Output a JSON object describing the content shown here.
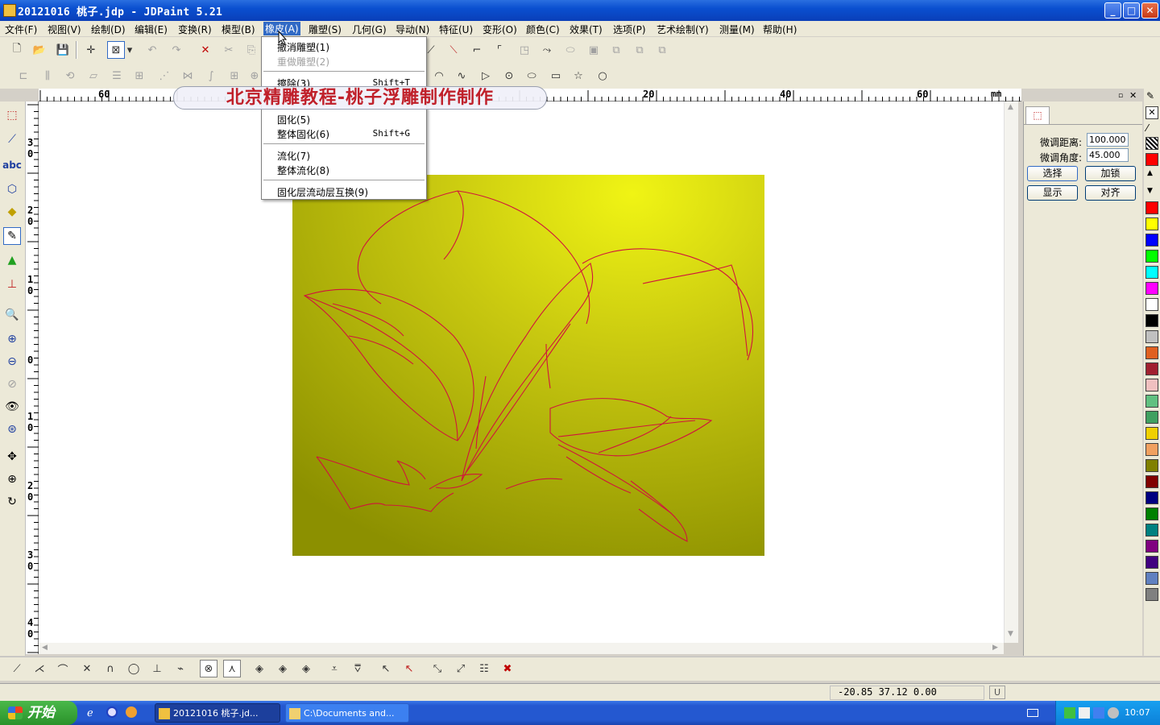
{
  "window": {
    "title": "20121016 桃子.jdp - JDPaint 5.21",
    "buttons": {
      "minimize": "_",
      "maximize": "□",
      "close": "✕"
    }
  },
  "menubar": [
    {
      "label": "文件(F)"
    },
    {
      "label": "视图(V)"
    },
    {
      "label": "绘制(D)"
    },
    {
      "label": "编辑(E)"
    },
    {
      "label": "变换(R)"
    },
    {
      "label": "模型(B)"
    },
    {
      "label": "橡皮(A)",
      "active": true
    },
    {
      "label": "雕塑(S)"
    },
    {
      "label": "几何(G)"
    },
    {
      "label": "导动(N)"
    },
    {
      "label": "特征(U)"
    },
    {
      "label": "变形(O)"
    },
    {
      "label": "颜色(C)"
    },
    {
      "label": "效果(T)"
    },
    {
      "label": "选项(P)"
    },
    {
      "label": "艺术绘制(Y)"
    },
    {
      "label": "测量(M)"
    },
    {
      "label": "帮助(H)"
    }
  ],
  "dropdown": {
    "items": [
      {
        "label": "撤消雕塑(1)",
        "shortcut": "",
        "disabled": false
      },
      {
        "label": "重做雕塑(2)",
        "shortcut": "",
        "disabled": true
      },
      {
        "label": "擦除(3)",
        "shortcut": "Shift+T",
        "disabled": false
      },
      {
        "label": "固化(5)",
        "shortcut": "",
        "disabled": false
      },
      {
        "label": "整体固化(6)",
        "shortcut": "Shift+G",
        "disabled": false
      },
      {
        "label": "流化(7)",
        "shortcut": "",
        "disabled": false
      },
      {
        "label": "整体流化(8)",
        "shortcut": "",
        "disabled": false
      },
      {
        "label": "固化层流动层互换(9)",
        "shortcut": "",
        "disabled": false
      }
    ]
  },
  "banner": {
    "text": "北京精雕教程-桃子浮雕制作制作"
  },
  "ruler_top": {
    "labels": [
      "60",
      "20",
      "40",
      "60"
    ],
    "unit": "mm"
  },
  "ruler_left": {
    "labels": [
      "30",
      "20",
      "10",
      "0",
      "10",
      "20",
      "30",
      "40"
    ]
  },
  "right_panel": {
    "fine_distance_label": "微调距离:",
    "fine_distance_value": "100.000",
    "fine_angle_label": "微调角度:",
    "fine_angle_value": "45.000",
    "buttons": {
      "select": "选择",
      "lock": "加锁",
      "show": "显示",
      "align": "对齐"
    }
  },
  "palette": {
    "colors": [
      "#ff0000",
      "#ffff00",
      "#0000ff",
      "#00ff00",
      "#00ffff",
      "#ff00ff",
      "#ffffff",
      "#000000",
      "#c0c0c0",
      "#e06020",
      "#a02030",
      "#f0c0c0",
      "#60c080",
      "#40a060",
      "#f0d000",
      "#f0a060",
      "#808000",
      "#800000",
      "#000080",
      "#008000",
      "#008080",
      "#800080",
      "#400080",
      "#6080c0",
      "#808080"
    ]
  },
  "status": {
    "coords": "-20.85  37.12  0.00",
    "units": "U"
  },
  "taskbar": {
    "start_label": "开始",
    "tasks": [
      {
        "label": "20121016 桃子.jd...",
        "active": true
      },
      {
        "label": "C:\\Documents and...",
        "active": false
      }
    ],
    "clock": "10:07"
  }
}
